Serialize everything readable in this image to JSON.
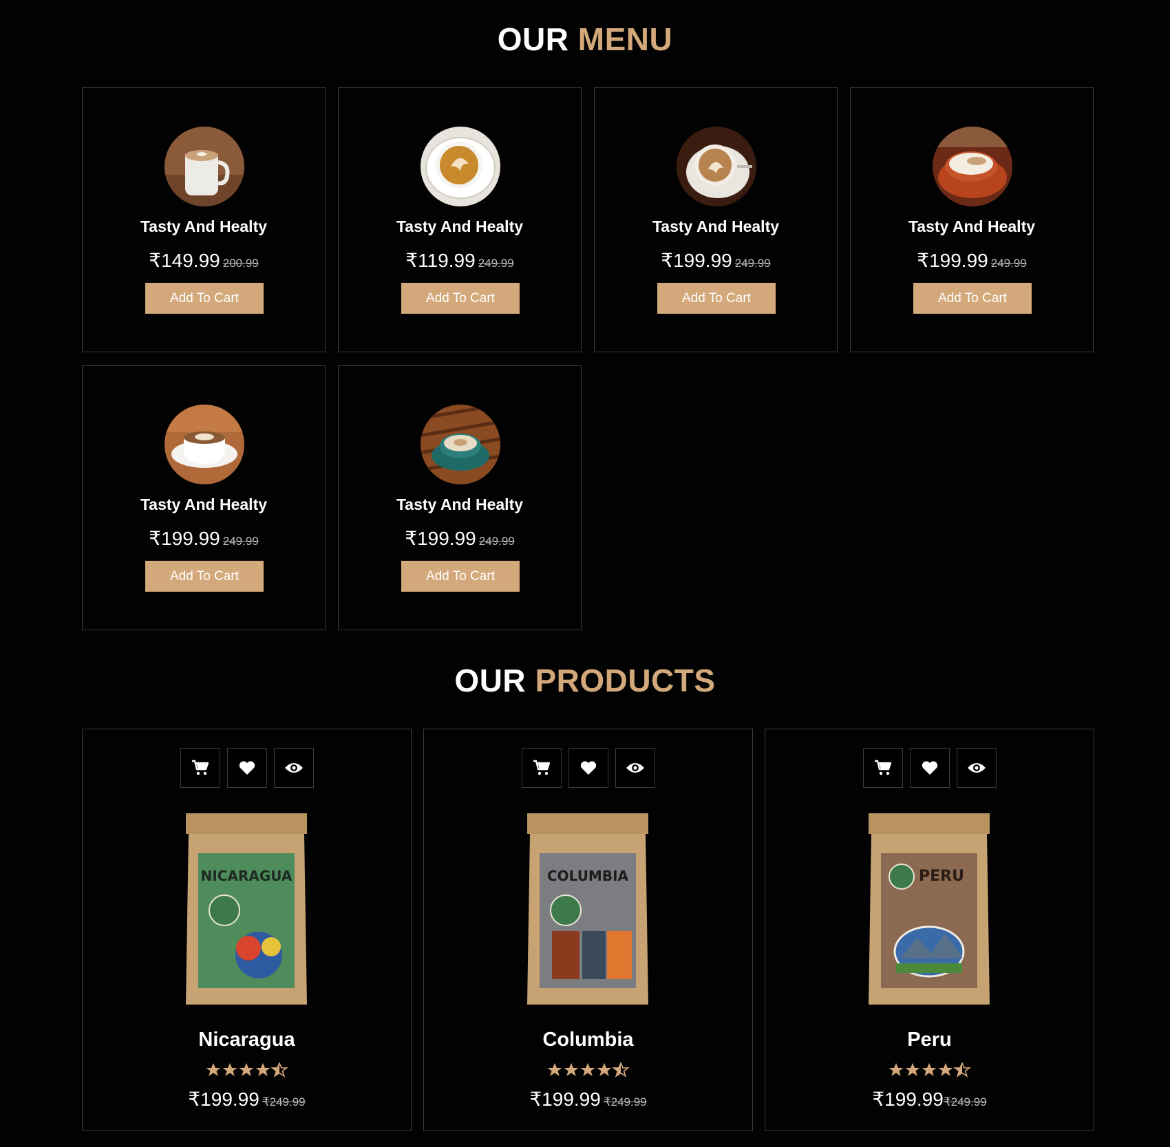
{
  "menu": {
    "heading_part1": "OUR",
    "heading_part2": "MENU",
    "items": [
      {
        "name": "Tasty And Healty",
        "price": "₹149.99",
        "old_price": "200.99",
        "button": "Add To Cart"
      },
      {
        "name": "Tasty And Healty",
        "price": "₹119.99",
        "old_price": "249.99",
        "button": "Add To Cart"
      },
      {
        "name": "Tasty And Healty",
        "price": "₹199.99",
        "old_price": "249.99",
        "button": "Add To Cart"
      },
      {
        "name": "Tasty And Healty",
        "price": "₹199.99",
        "old_price": "249.99",
        "button": "Add To Cart"
      },
      {
        "name": "Tasty And Healty",
        "price": "₹199.99",
        "old_price": "249.99",
        "button": "Add To Cart"
      },
      {
        "name": "Tasty And Healty",
        "price": "₹199.99",
        "old_price": "249.99",
        "button": "Add To Cart"
      }
    ]
  },
  "products": {
    "heading_part1": "OUR",
    "heading_part2": "PRODUCTS",
    "icons": [
      "cart-icon",
      "heart-icon",
      "eye-icon"
    ],
    "items": [
      {
        "name": "Nicaragua",
        "rating": 4.5,
        "price": "₹199.99",
        "old_price": "₹249.99",
        "bag_color": "#4f8c5c",
        "bag_label": "NICARAGUA"
      },
      {
        "name": "Columbia",
        "rating": 4.5,
        "price": "₹199.99",
        "old_price": "₹249.99",
        "bag_color": "#7b7d80",
        "bag_label": "COLUMBIA"
      },
      {
        "name": "Peru",
        "rating": 4.5,
        "price": "₹199.99",
        "old_price": "₹249.99",
        "bag_color": "#8c6a52",
        "bag_label": "PERU"
      }
    ]
  },
  "colors": {
    "accent": "#d3a87a",
    "background": "#020202",
    "border": "#3b3b3b"
  }
}
